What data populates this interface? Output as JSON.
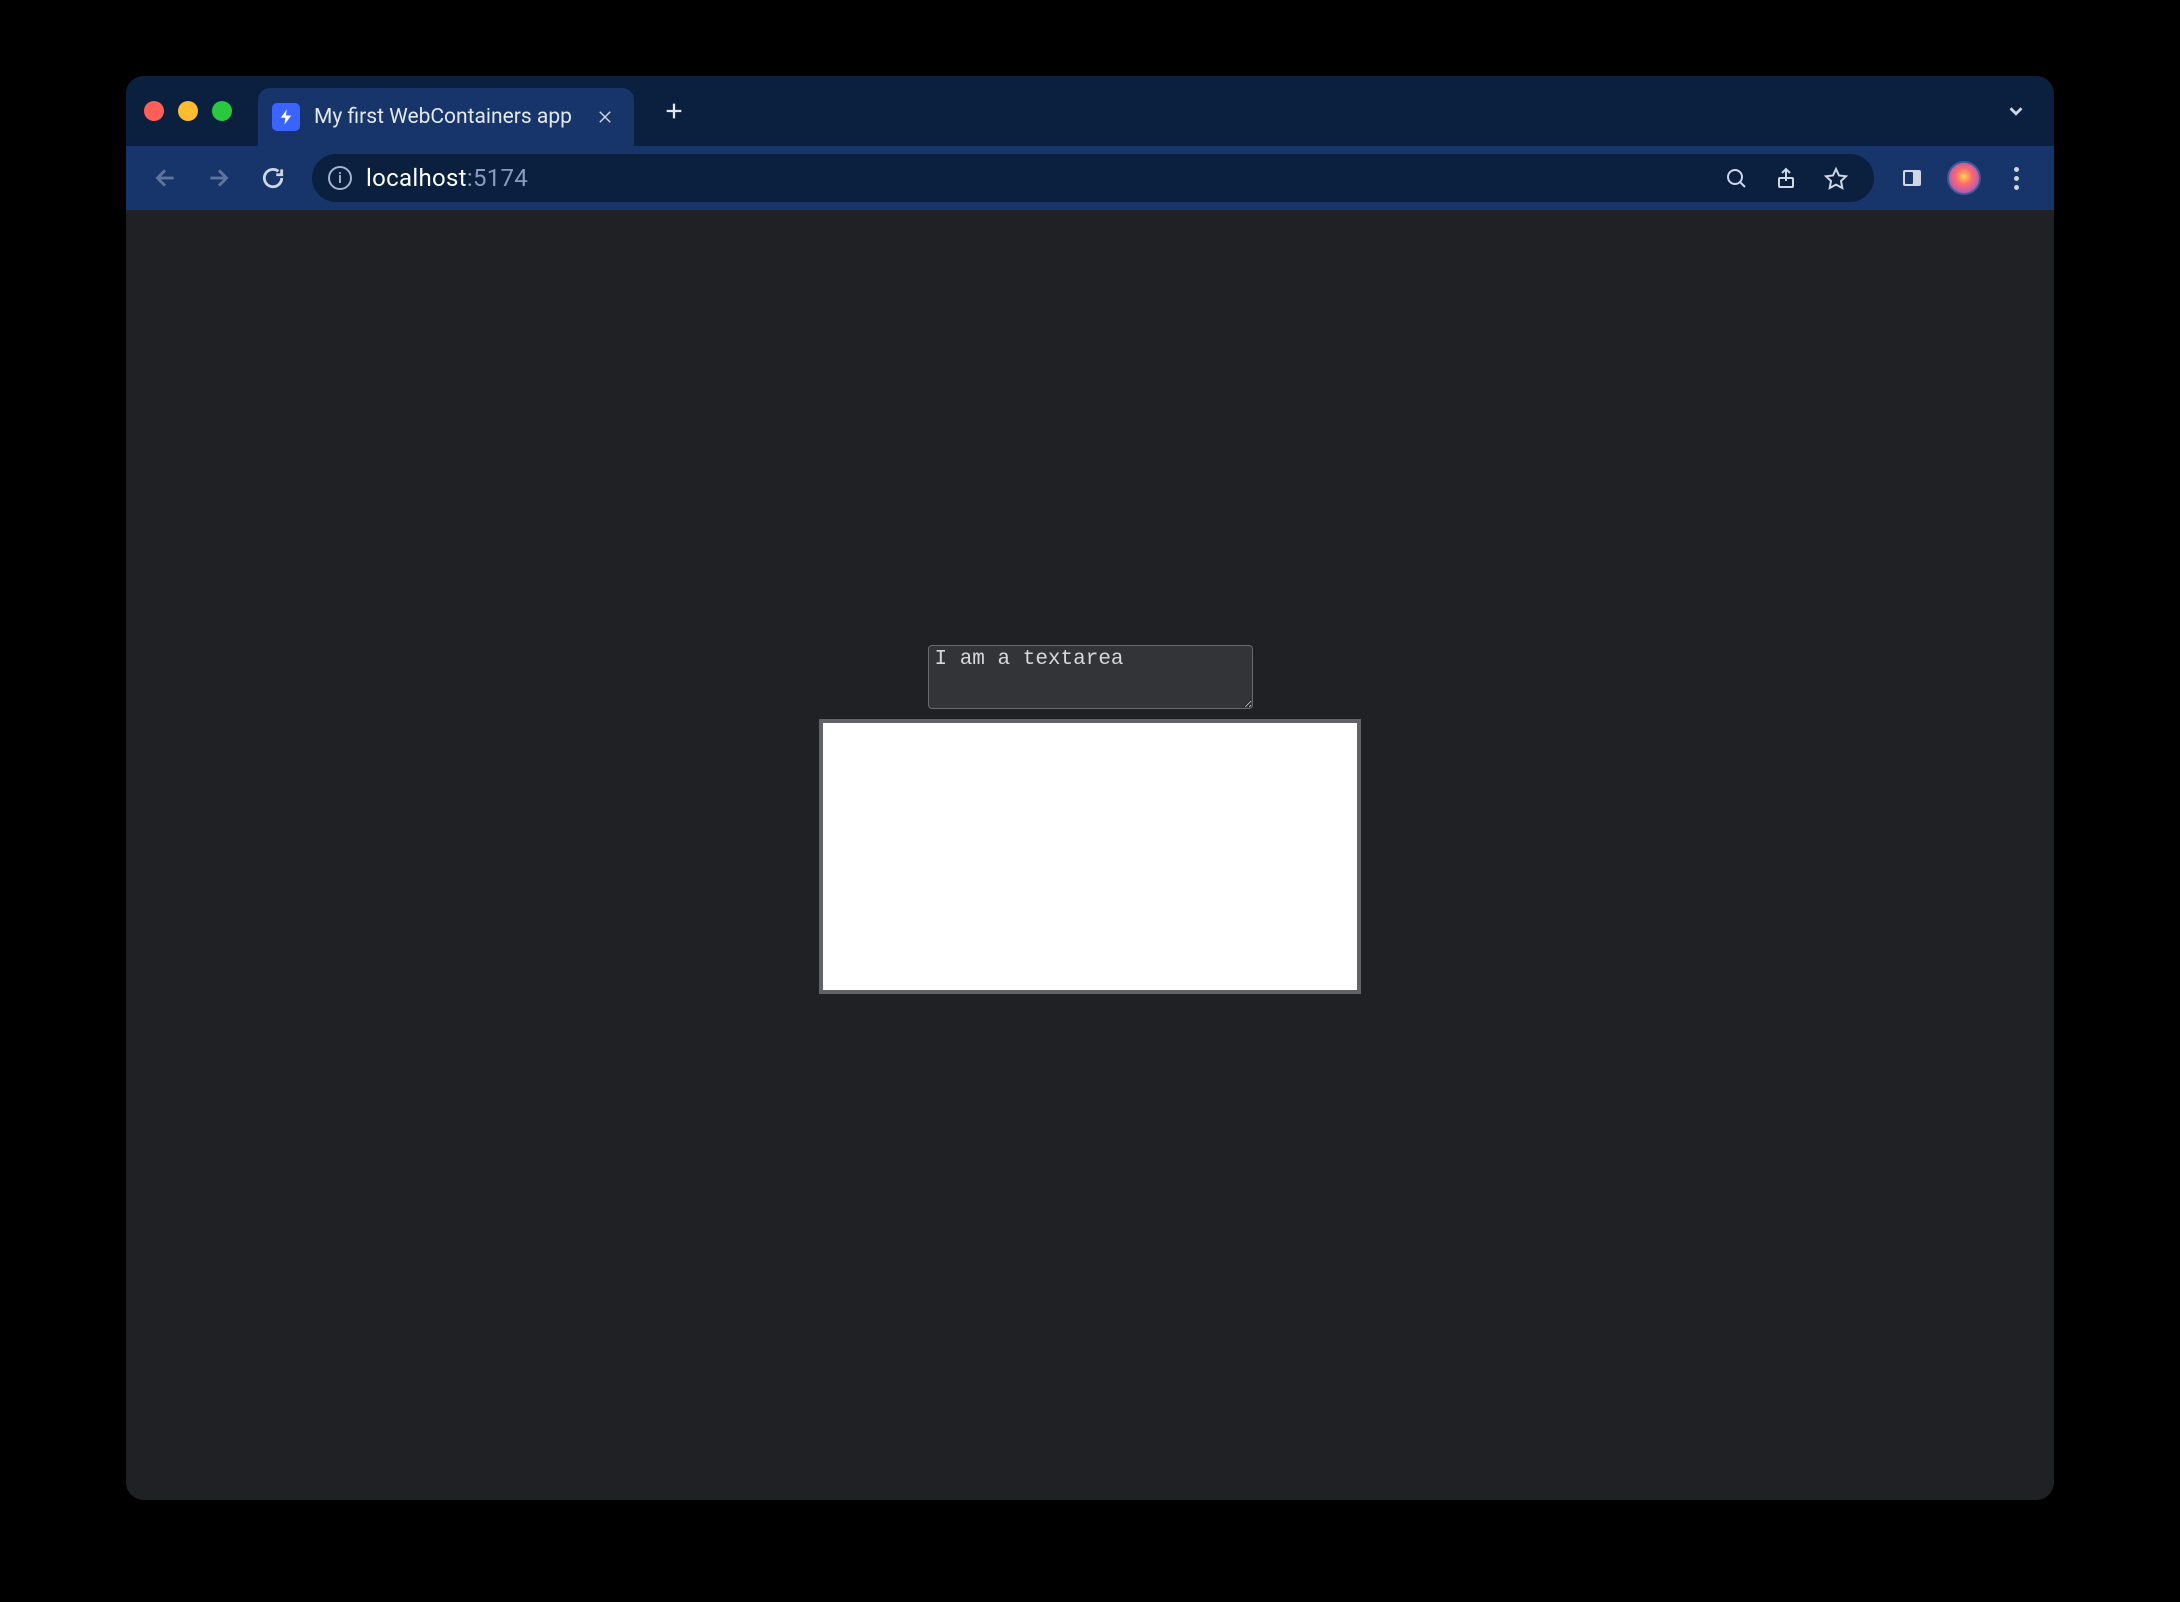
{
  "tab": {
    "title": "My first WebContainers app",
    "favicon": "bolt-icon"
  },
  "url": {
    "host": "localhost",
    "port": ":5174"
  },
  "page": {
    "textarea_value": "I am a textarea"
  },
  "icons": {
    "info_glyph": "i"
  }
}
